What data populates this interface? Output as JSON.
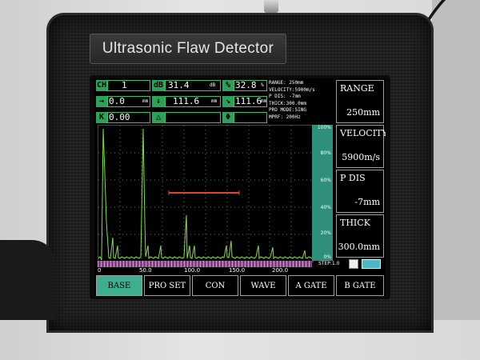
{
  "device_name": "Ultrasonic Flaw Detector",
  "top": {
    "ch": {
      "label": "CH",
      "value": "1"
    },
    "db": {
      "label": "dB",
      "value": "31.4",
      "unit": "dB"
    },
    "pct": {
      "label": "%",
      "value": "32.8",
      "unit": "%"
    },
    "row2a": {
      "label": "→",
      "value": "0.0",
      "unit": "mm"
    },
    "row2b": {
      "label": "↓",
      "value": "111.6",
      "unit": "mm"
    },
    "row2c": {
      "label": "↘",
      "value": "111.6",
      "unit": "mm"
    },
    "k": {
      "label": "K",
      "value": "0.00"
    },
    "triangle": {
      "label": "△",
      "value": ""
    },
    "phi": {
      "label": "Φ",
      "value": ""
    }
  },
  "params": [
    "RANGE: 250mm",
    "VELOCITY:5900m/s",
    "P DIS:  -7mm",
    "THICK:300.0mm",
    "PRO MODE:SING",
    "MPRF: 200Hz"
  ],
  "right_panel": [
    {
      "title": "RANGE",
      "value": "250mm"
    },
    {
      "title": "VELOCITY",
      "value": "5900m/s"
    },
    {
      "title": "P DIS",
      "value": "-7mm"
    },
    {
      "title": "THICK",
      "value": "300.0mm"
    }
  ],
  "scale_labels": [
    "100%",
    "80%",
    "60%",
    "40%",
    "20%",
    "0%"
  ],
  "axis_labels": [
    "0",
    "50.0",
    "100.0",
    "150.0",
    "200.0"
  ],
  "step_text": "STEP:1.0",
  "bottom_buttons": [
    "BASE",
    "PRO SET",
    "CON",
    "WAVE",
    "A GATE",
    "B GATE"
  ],
  "colors": {
    "waveform": "#7fe23a",
    "gate": "#e0442c",
    "accent": "#3fae8e"
  }
}
